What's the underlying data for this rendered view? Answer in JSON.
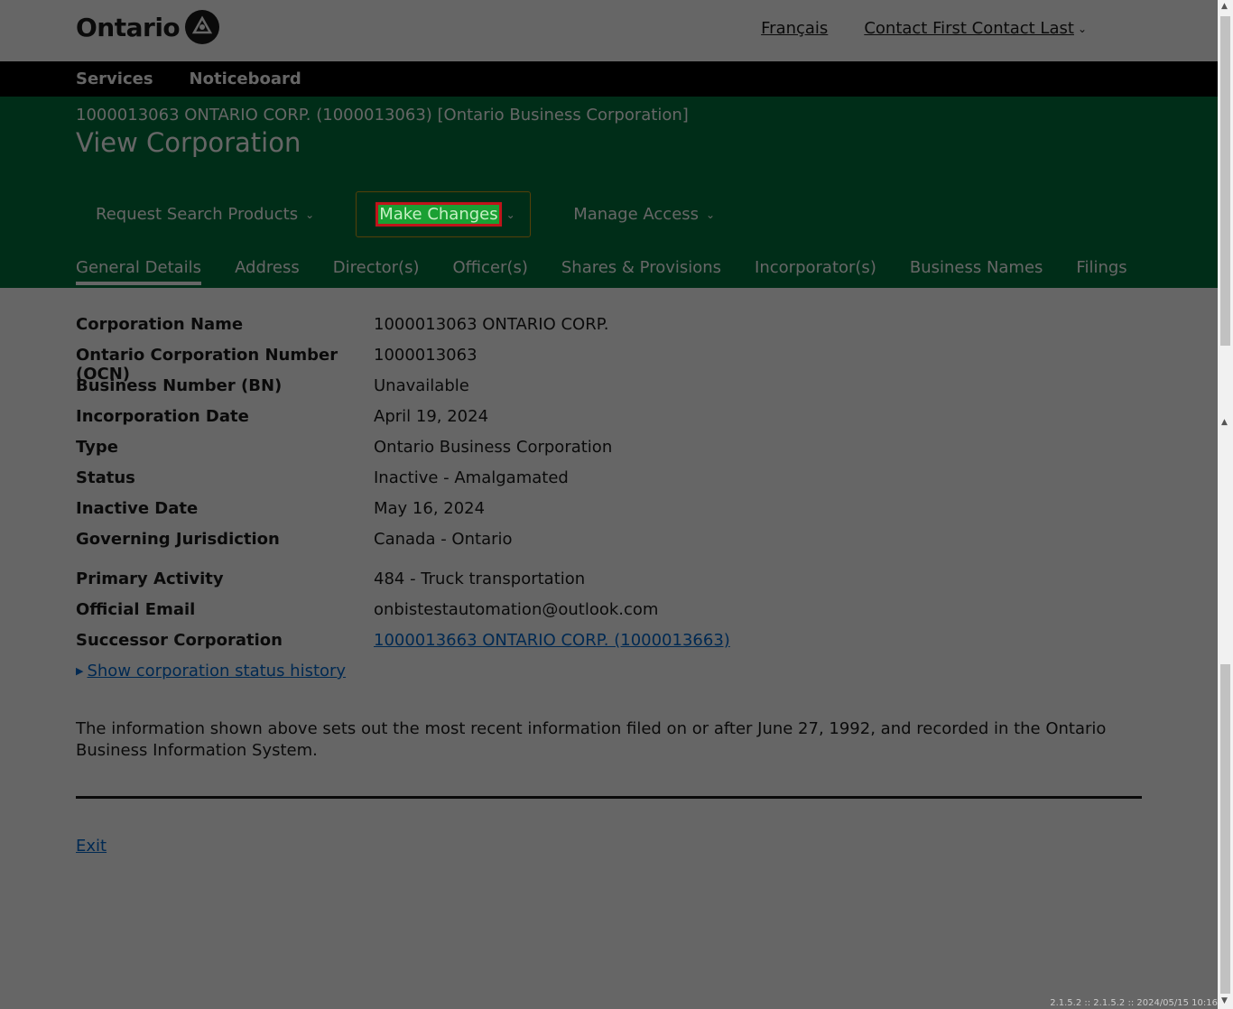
{
  "header": {
    "logo_text": "Ontario",
    "francais_link": "Français",
    "user_menu": "Contact First Contact Last"
  },
  "nav": {
    "services": "Services",
    "noticeboard": "Noticeboard"
  },
  "corp": {
    "subtitle": "1000013063 ONTARIO CORP. (1000013063) [Ontario Business Corporation]",
    "page_title": "View Corporation"
  },
  "actions": {
    "request_search": "Request Search Products",
    "make_changes": "Make Changes",
    "manage_access": "Manage Access"
  },
  "tabs": [
    "General Details",
    "Address",
    "Director(s)",
    "Officer(s)",
    "Shares & Provisions",
    "Incorporator(s)",
    "Business Names",
    "Filings"
  ],
  "details": [
    {
      "label": "Corporation Name",
      "value": "1000013063 ONTARIO CORP."
    },
    {
      "label": "Ontario Corporation Number (OCN)",
      "value": "1000013063"
    },
    {
      "label": "Business Number (BN)",
      "value": "Unavailable"
    },
    {
      "label": "Incorporation Date",
      "value": "April 19, 2024"
    },
    {
      "label": "Type",
      "value": "Ontario Business Corporation"
    },
    {
      "label": "Status",
      "value": "Inactive - Amalgamated"
    },
    {
      "label": "Inactive Date",
      "value": "May 16, 2024"
    },
    {
      "label": "Governing Jurisdiction",
      "value": "Canada - Ontario"
    },
    {
      "label": "Primary Activity",
      "value": "484 - Truck transportation"
    },
    {
      "label": "Official Email",
      "value": "onbistestautomation@outlook.com"
    },
    {
      "label": "Successor Corporation",
      "value": "1000013663 ONTARIO CORP. (1000013663)"
    }
  ],
  "history_link": "Show corporation status history",
  "note": "The information shown above sets out the most recent information filed on or after June 27, 1992, and recorded in the Ontario Business Information System.",
  "exit_link": "Exit",
  "version": "2.1.5.2 :: 2.1.5.2 :: 2024/05/15 10:16"
}
